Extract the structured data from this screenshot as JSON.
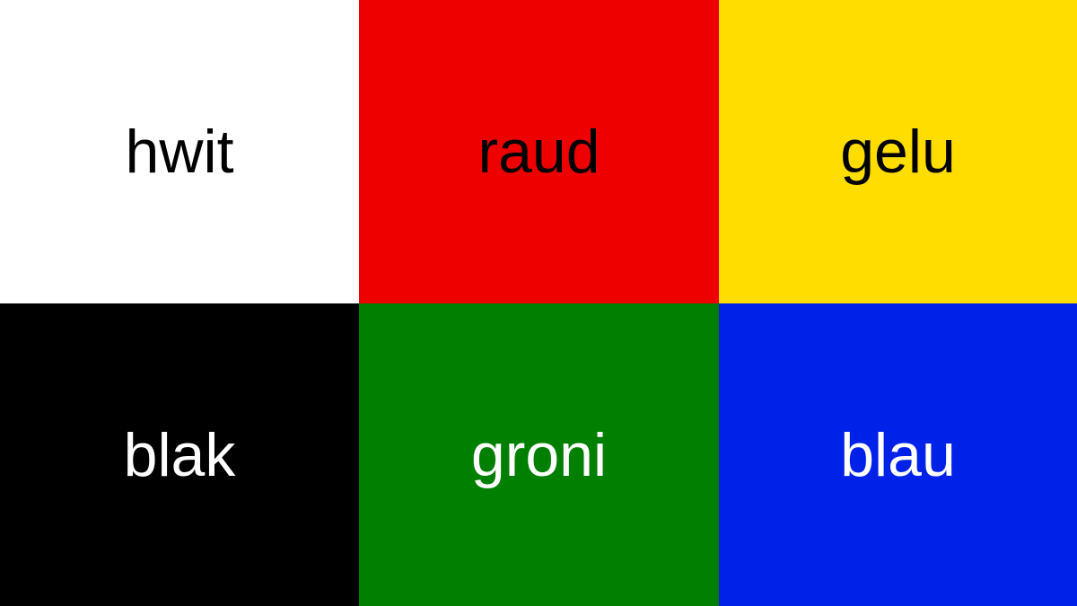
{
  "swatches": [
    {
      "word": "hwit",
      "background": "#ffffff",
      "text_color": "#000000"
    },
    {
      "word": "raud",
      "background": "#ee0000",
      "text_color": "#000000"
    },
    {
      "word": "gelu",
      "background": "#ffdd00",
      "text_color": "#000000"
    },
    {
      "word": "blak",
      "background": "#000000",
      "text_color": "#ffffff"
    },
    {
      "word": "groni",
      "background": "#007f00",
      "text_color": "#ffffff"
    },
    {
      "word": "blau",
      "background": "#0022e8",
      "text_color": "#ffffff"
    }
  ]
}
